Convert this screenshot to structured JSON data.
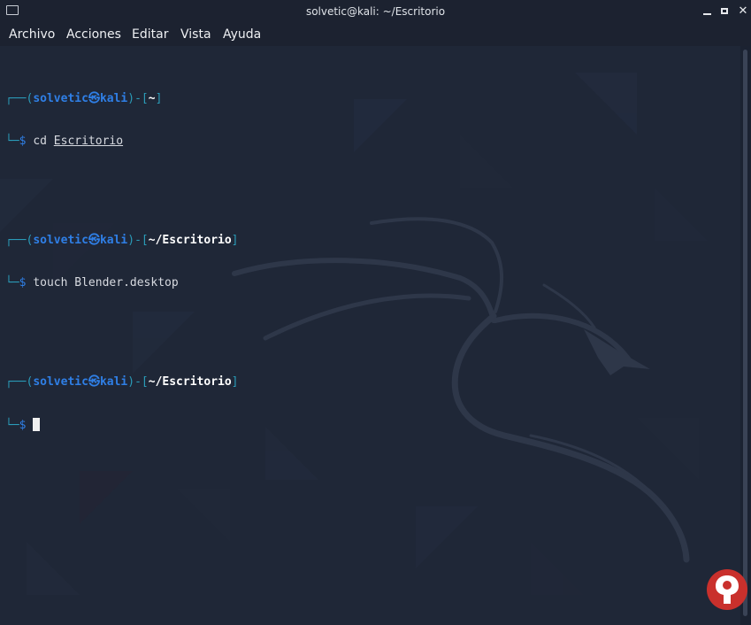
{
  "window": {
    "title": "solvetic@kali: ~/Escritorio"
  },
  "menu": {
    "items": [
      "Archivo",
      "Acciones",
      "Editar",
      "Vista",
      "Ayuda"
    ]
  },
  "terminal": {
    "blocks": [
      {
        "user": "solvetic",
        "host": "kali",
        "at_symbol": "㉿",
        "path": "~",
        "command_name": "cd",
        "command_arg": "Escritorio"
      },
      {
        "user": "solvetic",
        "host": "kali",
        "at_symbol": "㉿",
        "path": "~/Escritorio",
        "command_name": "touch",
        "command_arg": "Blender.desktop"
      },
      {
        "user": "solvetic",
        "host": "kali",
        "at_symbol": "㉿",
        "path": "~/Escritorio",
        "command_name": "",
        "command_arg": ""
      }
    ],
    "prompt_open": "┌──(",
    "prompt_sep": ")-[",
    "prompt_close": "]",
    "prompt_second": "└─",
    "prompt_dollar": "$"
  },
  "colors": {
    "background": "#1f2737",
    "bracket": "#2a9bb8",
    "user": "#2f7fe6",
    "path": "#ffffff"
  },
  "icons": {
    "app": "terminal-window-icon",
    "minimize": "minimize-icon",
    "maximize": "maximize-icon",
    "close": "close-icon",
    "watermark": "solvetic-logo-icon",
    "background": "kali-dragon-icon"
  }
}
